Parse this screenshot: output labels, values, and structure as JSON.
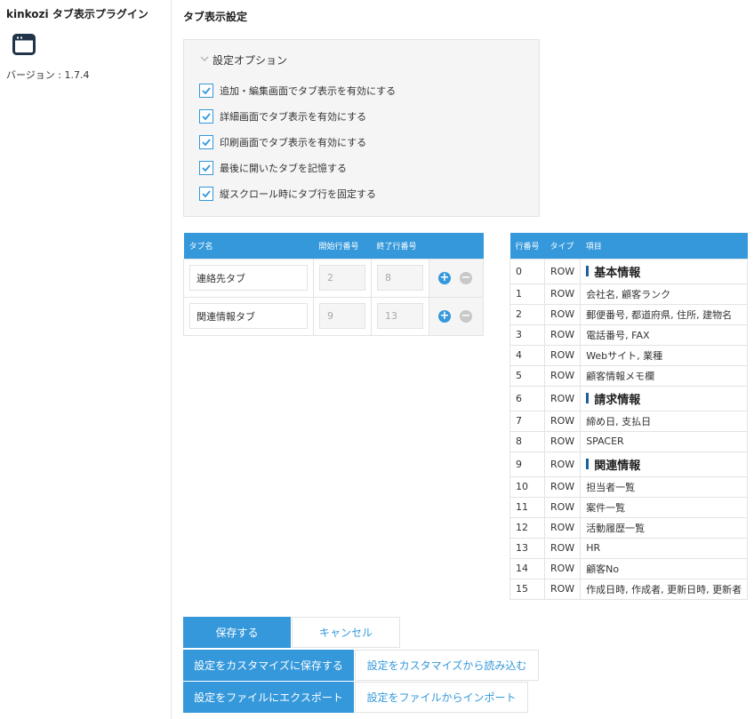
{
  "sidebar": {
    "title": "kinkozi タブ表示プラグイン",
    "icon": "browser-window-icon",
    "version": "バージョン : 1.7.4"
  },
  "main": {
    "title": "タブ表示設定",
    "options": {
      "header": "設定オプション",
      "items": [
        {
          "label": "追加・編集画面でタブ表示を有効にする",
          "checked": true
        },
        {
          "label": "詳細画面でタブ表示を有効にする",
          "checked": true
        },
        {
          "label": "印刷画面でタブ表示を有効にする",
          "checked": true
        },
        {
          "label": "最後に開いたタブを記憶する",
          "checked": true
        },
        {
          "label": "縦スクロール時にタブ行を固定する",
          "checked": true
        }
      ]
    },
    "tabs_table": {
      "headers": [
        "タブ名",
        "開始行番号",
        "終了行番号",
        ""
      ],
      "rows": [
        {
          "name": "連絡先タブ",
          "start": "2",
          "end": "8"
        },
        {
          "name": "関連情報タブ",
          "start": "9",
          "end": "13"
        }
      ]
    },
    "layout_table": {
      "headers": [
        "行番号",
        "タイプ",
        "項目"
      ],
      "rows": [
        {
          "no": "0",
          "type": "ROW",
          "item": "基本情報",
          "label": true
        },
        {
          "no": "1",
          "type": "ROW",
          "item": "会社名, 顧客ランク",
          "label": false
        },
        {
          "no": "2",
          "type": "ROW",
          "item": "郵便番号, 都道府県, 住所, 建物名",
          "label": false
        },
        {
          "no": "3",
          "type": "ROW",
          "item": "電話番号, FAX",
          "label": false
        },
        {
          "no": "4",
          "type": "ROW",
          "item": "Webサイト, 業種",
          "label": false
        },
        {
          "no": "5",
          "type": "ROW",
          "item": "顧客情報メモ欄",
          "label": false
        },
        {
          "no": "6",
          "type": "ROW",
          "item": "請求情報",
          "label": true
        },
        {
          "no": "7",
          "type": "ROW",
          "item": "締め日, 支払日",
          "label": false
        },
        {
          "no": "8",
          "type": "ROW",
          "item": "SPACER",
          "label": false
        },
        {
          "no": "9",
          "type": "ROW",
          "item": "関連情報",
          "label": true
        },
        {
          "no": "10",
          "type": "ROW",
          "item": "担当者一覧",
          "label": false
        },
        {
          "no": "11",
          "type": "ROW",
          "item": "案件一覧",
          "label": false
        },
        {
          "no": "12",
          "type": "ROW",
          "item": "活動履歴一覧",
          "label": false
        },
        {
          "no": "13",
          "type": "ROW",
          "item": "HR",
          "label": false
        },
        {
          "no": "14",
          "type": "ROW",
          "item": "顧客No",
          "label": false
        },
        {
          "no": "15",
          "type": "ROW",
          "item": "作成日時, 作成者, 更新日時, 更新者",
          "label": false
        }
      ]
    },
    "buttons": {
      "save": "保存する",
      "cancel": "キャンセル",
      "save_customize": "設定をカスタマイズに保存する",
      "load_customize": "設定をカスタマイズから読み込む",
      "export_file": "設定をファイルにエクスポート",
      "import_file": "設定をファイルからインポート"
    },
    "colors": {
      "accent": "#3498db",
      "label_bar": "#1f5f99",
      "panel_bg": "#f5f5f5",
      "border": "#e3e3e3"
    }
  }
}
